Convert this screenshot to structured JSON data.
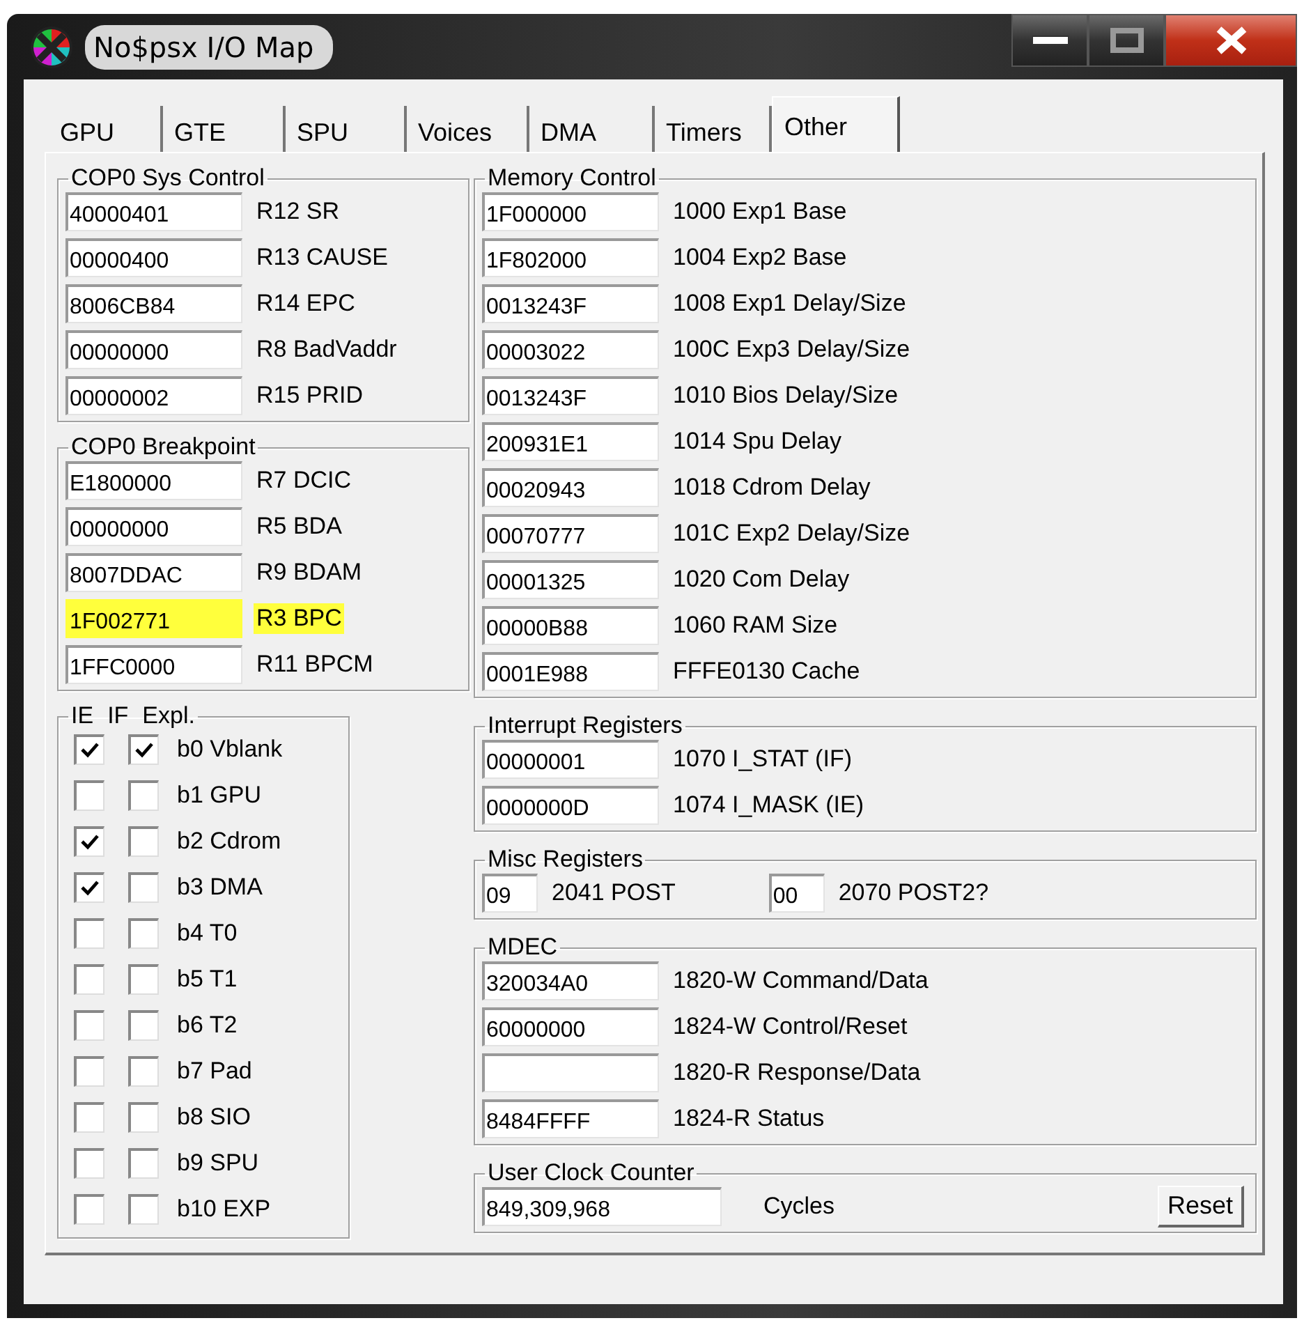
{
  "window": {
    "title": "No$psx I/O Map"
  },
  "tabs": [
    {
      "label": "GPU",
      "selected": false
    },
    {
      "label": "GTE",
      "selected": false
    },
    {
      "label": "SPU",
      "selected": false
    },
    {
      "label": "Voices",
      "selected": false
    },
    {
      "label": "DMA",
      "selected": false
    },
    {
      "label": "Timers",
      "selected": false
    },
    {
      "label": "Other",
      "selected": true
    }
  ],
  "cop0_sys_control": {
    "title": "COP0 Sys Control",
    "rows": [
      {
        "value": "40000401",
        "label": "R12 SR",
        "highlighted": false
      },
      {
        "value": "00000400",
        "label": "R13 CAUSE",
        "highlighted": false
      },
      {
        "value": "8006CB84",
        "label": "R14 EPC",
        "highlighted": false
      },
      {
        "value": "00000000",
        "label": "R8 BadVaddr",
        "highlighted": false
      },
      {
        "value": "00000002",
        "label": "R15 PRID",
        "highlighted": false
      }
    ]
  },
  "cop0_breakpoint": {
    "title": "COP0 Breakpoint",
    "rows": [
      {
        "value": "E1800000",
        "label": "R7 DCIC",
        "highlighted": false
      },
      {
        "value": "00000000",
        "label": "R5 BDA",
        "highlighted": false
      },
      {
        "value": "8007DDAC",
        "label": "R9 BDAM",
        "highlighted": false
      },
      {
        "value": "1F002771",
        "label": "R3 BPC",
        "highlighted": true
      },
      {
        "value": "1FFC0000",
        "label": "R11 BPCM",
        "highlighted": false
      }
    ]
  },
  "interrupt_bits": {
    "title_parts": [
      "IE",
      "IF",
      "Expl."
    ],
    "rows": [
      {
        "ie": true,
        "if": true,
        "label": "b0 Vblank"
      },
      {
        "ie": false,
        "if": false,
        "label": "b1 GPU"
      },
      {
        "ie": true,
        "if": false,
        "label": "b2 Cdrom"
      },
      {
        "ie": true,
        "if": false,
        "label": "b3 DMA"
      },
      {
        "ie": false,
        "if": false,
        "label": "b4 T0"
      },
      {
        "ie": false,
        "if": false,
        "label": "b5 T1"
      },
      {
        "ie": false,
        "if": false,
        "label": "b6 T2"
      },
      {
        "ie": false,
        "if": false,
        "label": "b7 Pad"
      },
      {
        "ie": false,
        "if": false,
        "label": "b8 SIO"
      },
      {
        "ie": false,
        "if": false,
        "label": "b9 SPU"
      },
      {
        "ie": false,
        "if": false,
        "label": "b10 EXP"
      }
    ]
  },
  "memory_control": {
    "title": "Memory Control",
    "rows": [
      {
        "value": "1F000000",
        "label": "1000 Exp1 Base"
      },
      {
        "value": "1F802000",
        "label": "1004 Exp2 Base"
      },
      {
        "value": "0013243F",
        "label": "1008 Exp1 Delay/Size"
      },
      {
        "value": "00003022",
        "label": "100C Exp3 Delay/Size"
      },
      {
        "value": "0013243F",
        "label": "1010 Bios Delay/Size"
      },
      {
        "value": "200931E1",
        "label": "1014 Spu Delay"
      },
      {
        "value": "00020943",
        "label": "1018 Cdrom Delay"
      },
      {
        "value": "00070777",
        "label": "101C Exp2 Delay/Size"
      },
      {
        "value": "00001325",
        "label": "1020 Com Delay"
      },
      {
        "value": "00000B88",
        "label": "1060 RAM Size"
      },
      {
        "value": "0001E988",
        "label": "FFFE0130 Cache"
      }
    ]
  },
  "interrupt_registers": {
    "title": "Interrupt Registers",
    "rows": [
      {
        "value": "00000001",
        "label": "1070 I_STAT (IF)"
      },
      {
        "value": "0000000D",
        "label": "1074 I_MASK (IE)"
      }
    ]
  },
  "misc_registers": {
    "title": "Misc Registers",
    "fields": [
      {
        "value": "09",
        "label": "2041 POST"
      },
      {
        "value": "00",
        "label": "2070 POST2?"
      }
    ]
  },
  "mdec": {
    "title": "MDEC",
    "rows": [
      {
        "value": "320034A0",
        "label": "1820-W Command/Data"
      },
      {
        "value": "60000000",
        "label": "1824-W Control/Reset"
      },
      {
        "label": "1820-R Response/Data"
      },
      {
        "value": "8484FFFF",
        "label": "1824-R Status"
      }
    ]
  },
  "user_clock_counter": {
    "title": "User Clock Counter",
    "value": "849,309,968",
    "label": "Cycles",
    "button": "Reset"
  }
}
